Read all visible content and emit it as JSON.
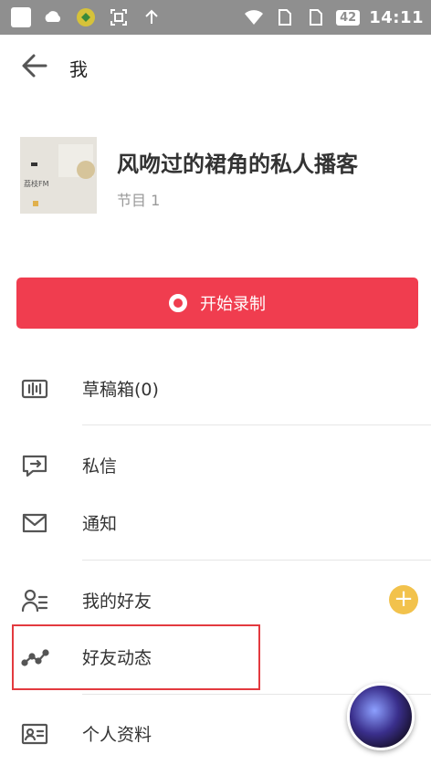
{
  "status_bar": {
    "battery": "42",
    "time": "14:11"
  },
  "header": {
    "title": "我"
  },
  "podcast": {
    "cover_logo": "荔枝FM",
    "name": "风吻过的裙角的私人播客",
    "episode_count": "节目 1"
  },
  "record_button": {
    "label": "开始录制"
  },
  "menu": {
    "items": [
      {
        "label": "草稿箱(0)",
        "icon": "drafts-icon"
      },
      {
        "label": "私信",
        "icon": "message-icon"
      },
      {
        "label": "通知",
        "icon": "mail-icon"
      },
      {
        "label": "我的好友",
        "icon": "friends-icon"
      },
      {
        "label": "好友动态",
        "icon": "activity-icon"
      },
      {
        "label": "个人资料",
        "icon": "profile-card-icon"
      }
    ]
  },
  "colors": {
    "accent": "#f03d4f",
    "plus": "#f2c24c",
    "highlight": "#e33a3f"
  }
}
